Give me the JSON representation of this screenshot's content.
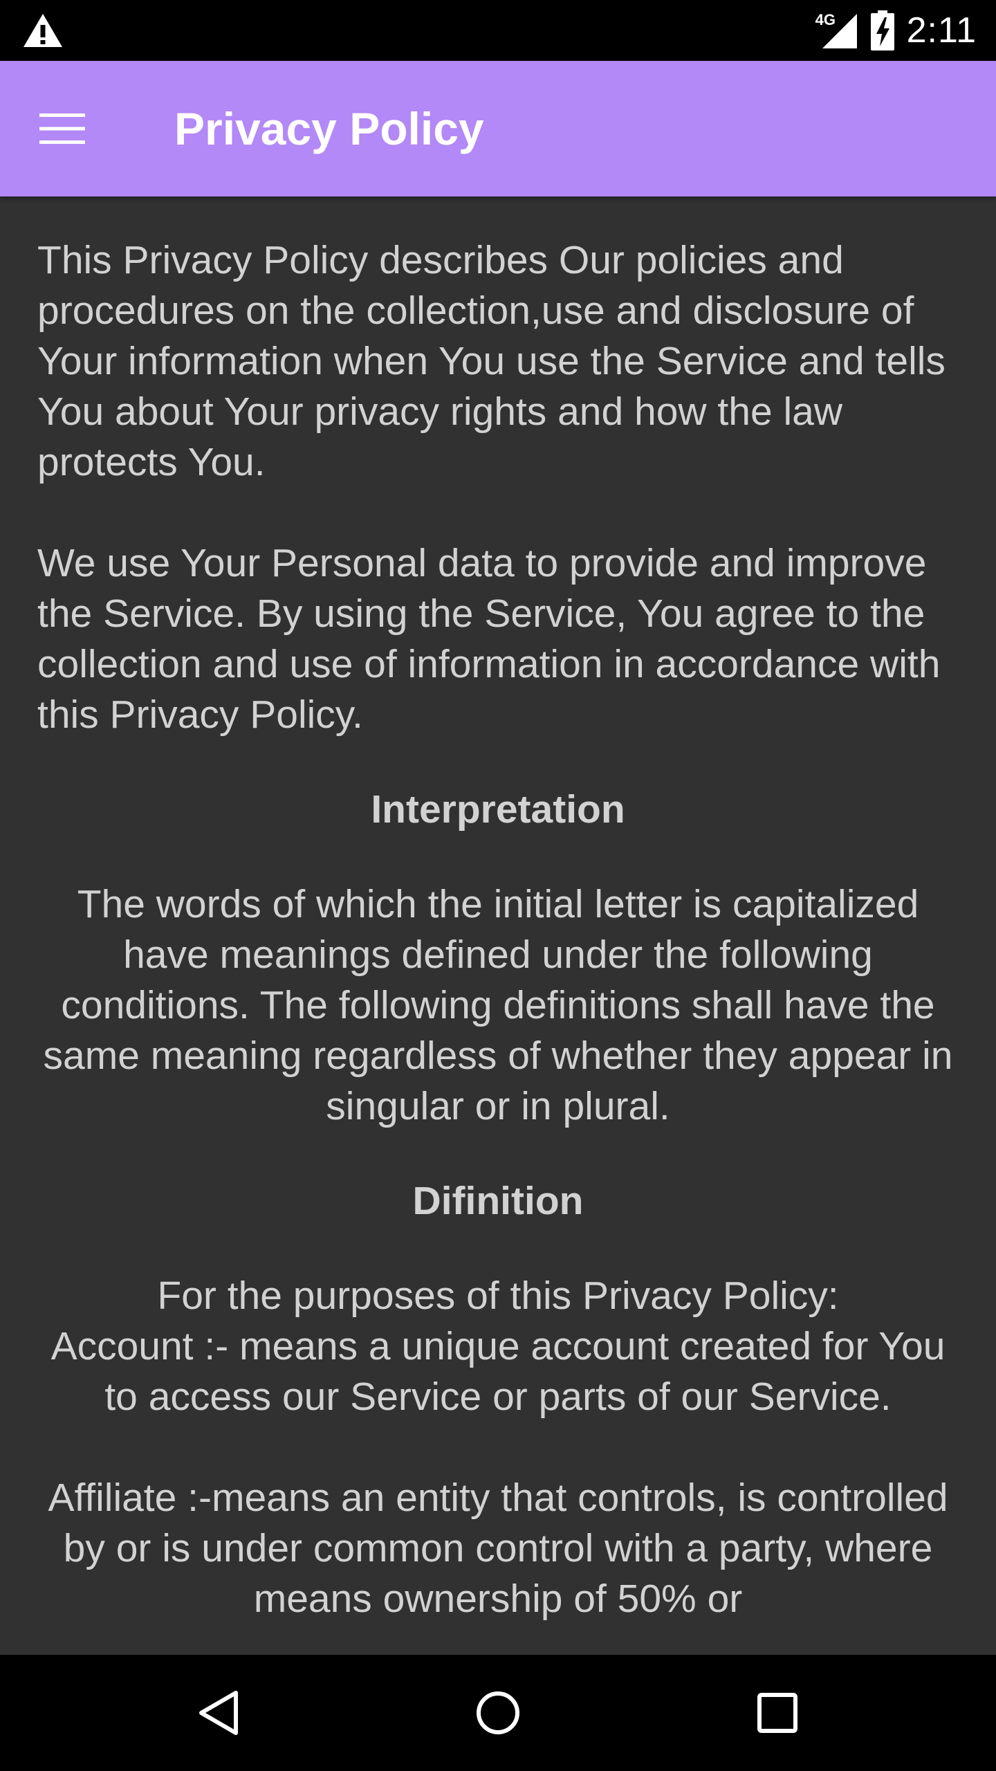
{
  "status_bar": {
    "network_label": "4G",
    "time": "2:11"
  },
  "app_bar": {
    "title": "Privacy Policy",
    "color": "#b388f7"
  },
  "content": {
    "intro_paragraph_1": "This Privacy Policy describes Our policies and procedures on the collection,use and disclosure of Your information when You use the Service and tells You about Your privacy rights and how the law protects You.",
    "intro_paragraph_2": "We use Your Personal data to provide and improve the Service. By using the Service, You agree to the collection and use of information in accordance with this Privacy Policy.",
    "interpretation_heading": "Interpretation",
    "interpretation_text": "The words of which the initial letter is capitalized have meanings defined under the following conditions. The following definitions shall have the same meaning regardless of whether they appear in singular or in plural.",
    "definition_heading": "Difinition",
    "definition_intro": "For the purposes of this Privacy Policy:",
    "account_definition": "Account :- means a unique account created for You to access our Service or parts of our Service.",
    "affiliate_definition": "Affiliate :-means an entity that controls, is controlled by or is under common control with a party, where means ownership of 50% or"
  },
  "icons": {
    "warning": "warning-icon",
    "signal": "signal-4g-icon",
    "battery": "battery-charging-icon",
    "menu": "menu-icon",
    "back": "back-icon",
    "home": "home-icon",
    "recents": "recents-icon"
  }
}
